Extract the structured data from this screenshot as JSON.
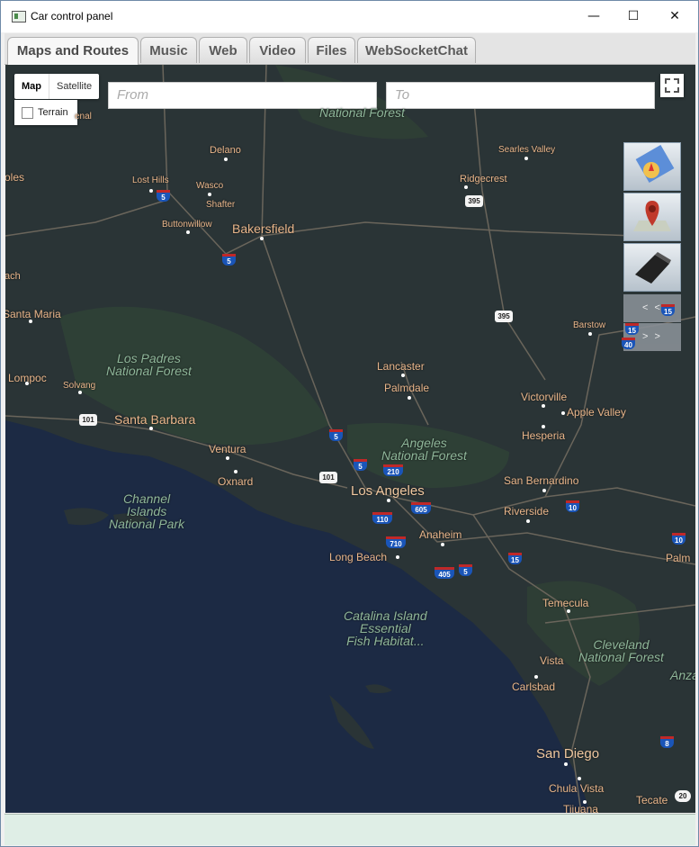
{
  "window": {
    "title": "Car control panel",
    "minimize": "—",
    "maximize": "☐",
    "close": "✕"
  },
  "tabs": [
    {
      "label": "Maps and Routes",
      "active": true
    },
    {
      "label": "Music"
    },
    {
      "label": "Web"
    },
    {
      "label": "Video"
    },
    {
      "label": "Files"
    },
    {
      "label": "WebSocketChat"
    }
  ],
  "map": {
    "map_type_buttons": [
      "Map",
      "Satellite"
    ],
    "terrain_label": "Terrain",
    "from_placeholder": "From",
    "to_placeholder": "To",
    "nav_prev": "< <",
    "nav_next": "> >",
    "cities": {
      "los_angeles": "Los Angeles",
      "san_diego": "San Diego",
      "bakersfield": "Bakersfield",
      "santa_barbara": "Santa Barbara",
      "lancaster": "Lancaster",
      "palmdale": "Palmdale",
      "long_beach": "Long Beach",
      "anaheim": "Anaheim",
      "riverside": "Riverside",
      "san_bernardino": "San Bernardino",
      "victorville": "Victorville",
      "apple_valley": "Apple Valley",
      "hesperia": "Hesperia",
      "ventura": "Ventura",
      "oxnard": "Oxnard",
      "temecula": "Temecula",
      "vista": "Vista",
      "carlsbad": "Carlsbad",
      "chula_vista": "Chula Vista",
      "tijuana": "Tijuana",
      "tecate": "Tecate",
      "palm": "Palm",
      "lompoc": "Lompoc",
      "solvang": "Solvang",
      "santa_maria": "Santa Maria",
      "delano": "Delano",
      "wasco": "Wasco",
      "shafter": "Shafter",
      "lost_hills": "Lost Hills",
      "buttonwillow": "Buttonwillow",
      "ridgecrest": "Ridgecrest",
      "searles_valley": "Searles Valley",
      "barstow": "Barstow",
      "oles": "oles",
      "ach": "ach",
      "enal": "enal"
    },
    "parks": {
      "los_padres": "Los Padres\nNational Forest",
      "angeles": "Angeles\nNational Forest",
      "channel_islands": "Channel\nIslands\nNational Park",
      "catalina": "Catalina Island\nEssential\nFish Habitat...",
      "cleveland": "Cleveland\nNational Forest",
      "sequoia_top": "National Forest",
      "anza": "Anza"
    },
    "shields": {
      "i5a": "5",
      "i5b": "5",
      "i5c": "5",
      "i5d": "5",
      "i5e": "5",
      "us395a": "395",
      "us395b": "395",
      "i15a": "15",
      "i15b": "15",
      "i15c": "15",
      "i40": "40",
      "us101a": "101",
      "us101b": "101",
      "i210": "210",
      "i605": "605",
      "i110": "110",
      "i710": "710",
      "i405": "405",
      "i10a": "10",
      "i10b": "10",
      "i8": "8",
      "i20d": "20"
    }
  }
}
